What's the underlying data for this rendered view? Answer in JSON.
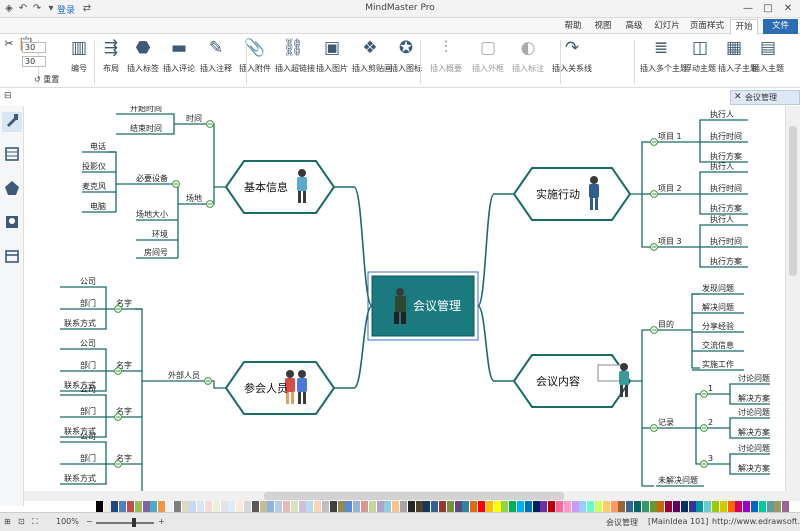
{
  "app": {
    "title": "MindMaster Pro",
    "login_label": "登录"
  },
  "tabs": [
    {
      "label": "文件",
      "kind": "file"
    },
    {
      "label": "开始",
      "kind": "active"
    },
    {
      "label": "页面样式",
      "kind": ""
    },
    {
      "label": "幻灯片",
      "kind": ""
    },
    {
      "label": "高级",
      "kind": ""
    },
    {
      "label": "视图",
      "kind": ""
    },
    {
      "label": "帮助",
      "kind": ""
    }
  ],
  "ribbon": {
    "buttons": [
      {
        "label": "插入主题",
        "icon": "insert-topic-icon",
        "dim": false
      },
      {
        "label": "插入子主题",
        "icon": "insert-subtopic-icon",
        "dim": false
      },
      {
        "label": "浮动主题",
        "icon": "floating-topic-icon",
        "dim": false
      },
      {
        "label": "插入多个主题",
        "icon": "insert-multiple-topics-icon",
        "dim": false
      },
      {
        "label": "插入关系线",
        "icon": "relationship-icon",
        "dim": false
      },
      {
        "label": "插入标注",
        "icon": "callout-icon",
        "dim": true
      },
      {
        "label": "插入外框",
        "icon": "boundary-icon",
        "dim": true
      },
      {
        "label": "插入概要",
        "icon": "summary-icon",
        "dim": true
      },
      {
        "label": "插入图标",
        "icon": "insert-icon-icon",
        "dim": false
      },
      {
        "label": "插入剪贴画",
        "icon": "clipart-icon",
        "dim": false
      },
      {
        "label": "插入图片",
        "icon": "insert-picture-icon",
        "dim": false
      },
      {
        "label": "插入超链接",
        "icon": "hyperlink-icon",
        "dim": false
      },
      {
        "label": "插入附件",
        "icon": "attachment-icon",
        "dim": false
      },
      {
        "label": "插入注释",
        "icon": "note-icon",
        "dim": false
      },
      {
        "label": "插入评论",
        "icon": "comment-icon",
        "dim": false
      },
      {
        "label": "插入标签",
        "icon": "tag-icon",
        "dim": false
      },
      {
        "label": "布局",
        "icon": "layout-icon",
        "dim": false
      },
      {
        "label": "编号",
        "icon": "numbering-icon",
        "dim": false
      }
    ],
    "spin_values": [
      "30",
      "30"
    ],
    "reset_label": "重置"
  },
  "doc_tab": {
    "label": "会议管理"
  },
  "mindmap": {
    "central": "会议管理",
    "main": [
      {
        "label": "基本信息",
        "side": "left"
      },
      {
        "label": "参会人员",
        "side": "left"
      },
      {
        "label": "实施行动",
        "side": "right"
      },
      {
        "label": "会议内容",
        "side": "right"
      }
    ],
    "basic_info": {
      "time": {
        "label": "时间",
        "children": [
          "开始时间",
          "结束时间"
        ]
      },
      "venue": {
        "label": "场地",
        "needs": "必要设备",
        "devices": [
          "电话",
          "投影仪",
          "麦克风",
          "电脑"
        ],
        "others": [
          "场地大小",
          "环境",
          "房间号"
        ]
      }
    },
    "attendees": {
      "external": "外部人员",
      "blocks": [
        {
          "name": "名字",
          "children": [
            "公司",
            "部门",
            "联系方式"
          ]
        },
        {
          "name": "名字",
          "children": [
            "公司",
            "部门",
            "联系方式"
          ]
        },
        {
          "name": "名字",
          "children": [
            "公司",
            "部门",
            "联系方式"
          ]
        },
        {
          "name": "名字",
          "children": [
            "公司",
            "部门",
            "联系方式"
          ]
        }
      ]
    },
    "actions": {
      "items": [
        {
          "label": "项目 1",
          "children": [
            "执行人",
            "执行时间",
            "执行方案"
          ]
        },
        {
          "label": "项目 2",
          "children": [
            "执行人",
            "执行时间",
            "执行方案"
          ]
        },
        {
          "label": "项目 3",
          "children": [
            "执行人",
            "执行时间",
            "执行方案"
          ]
        }
      ]
    },
    "content": {
      "purpose": {
        "label": "目的",
        "children": [
          "发现问题",
          "解决问题",
          "分享经验",
          "交流信息",
          "实施工作"
        ]
      },
      "records": {
        "label": "记录",
        "groups": [
          {
            "label": "1",
            "children": [
              "讨论问题",
              "解决方案"
            ]
          },
          {
            "label": "2",
            "children": [
              "讨论问题",
              "解决方案"
            ]
          },
          {
            "label": "3",
            "children": [
              "讨论问题",
              "解决方案"
            ]
          }
        ]
      },
      "pending": "未解决问题"
    }
  },
  "status": {
    "url": "http://www.edrawsoft.cn",
    "mainidea": "[MainIdea 101]",
    "doc": "会议管理",
    "zoom": "100%"
  },
  "palette_colors": [
    "#ffffff",
    "#000000",
    "#eeece1",
    "#1f497d",
    "#4f81bd",
    "#c0504d",
    "#9bbb59",
    "#8064a2",
    "#4bacc6",
    "#f79646",
    "#f2f2f2",
    "#7f7f7f",
    "#ddd9c3",
    "#c6d9f0",
    "#dbe5f1",
    "#f2dcdb",
    "#ebf1dd",
    "#e5e0ec",
    "#dbeef3",
    "#fdeada",
    "#d8d8d8",
    "#595959",
    "#c4bd97",
    "#8db3e2",
    "#b8cce4",
    "#e5b9b7",
    "#d7e3bc",
    "#ccc1d9",
    "#b7dde8",
    "#fbd5b5",
    "#bfbfbf",
    "#3f3f3f",
    "#938953",
    "#548dd4",
    "#95b3d7",
    "#d99694",
    "#c3d69b",
    "#b2a2c7",
    "#92cddc",
    "#fac08f",
    "#a5a5a5",
    "#262626",
    "#494429",
    "#17365d",
    "#366092",
    "#953734",
    "#76923c",
    "#5f497a",
    "#31859b",
    "#e36c09",
    "#ff0000",
    "#ffc000",
    "#ffff00",
    "#92d050",
    "#00b050",
    "#00b0f0",
    "#0070c0",
    "#002060",
    "#7030a0",
    "#c00000",
    "#ff6699",
    "#ff99cc",
    "#cc99ff",
    "#99ccff",
    "#66ffcc",
    "#ccff66",
    "#ffcc66",
    "#ff9966",
    "#996633",
    "#336699",
    "#006666",
    "#339966",
    "#669933",
    "#cc6600",
    "#990033",
    "#660066",
    "#003366",
    "#333399",
    "#009999",
    "#66cccc",
    "#99cc00",
    "#cccc00",
    "#ff6600",
    "#cc0066",
    "#9900cc",
    "#0066cc",
    "#00cc99",
    "#669999",
    "#999966",
    "#996699"
  ]
}
